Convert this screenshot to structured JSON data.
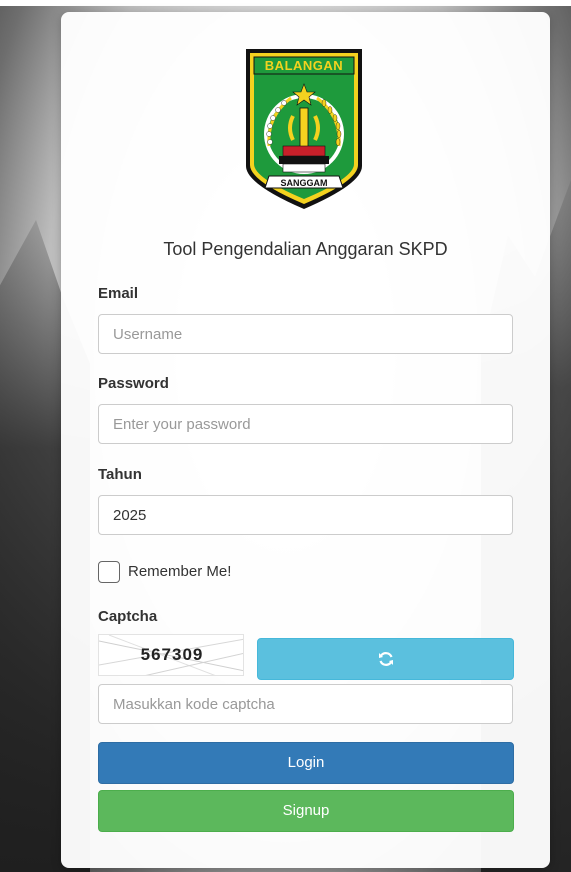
{
  "header": {
    "logo_banner_text": "BALANGAN",
    "logo_ribbon_text": "SANGGAM",
    "app_title": "Tool Pengendalian Anggaran SKPD"
  },
  "form": {
    "email": {
      "label": "Email",
      "value": "",
      "placeholder": "Username"
    },
    "password": {
      "label": "Password",
      "value": "",
      "placeholder": "Enter your password"
    },
    "tahun": {
      "label": "Tahun",
      "value": "2025"
    },
    "remember": {
      "label": "Remember Me!",
      "checked": false
    },
    "captcha": {
      "label": "Captcha",
      "code": "567309",
      "refresh_icon": "refresh-icon",
      "input_value": "",
      "input_placeholder": "Masukkan kode captcha"
    },
    "login_label": "Login",
    "signup_label": "Signup"
  },
  "colors": {
    "login": "#337ab7",
    "signup": "#5cb85c",
    "refresh": "#5bc0de",
    "logo_green": "#1e9a3c",
    "logo_yellow": "#f4d21f"
  }
}
